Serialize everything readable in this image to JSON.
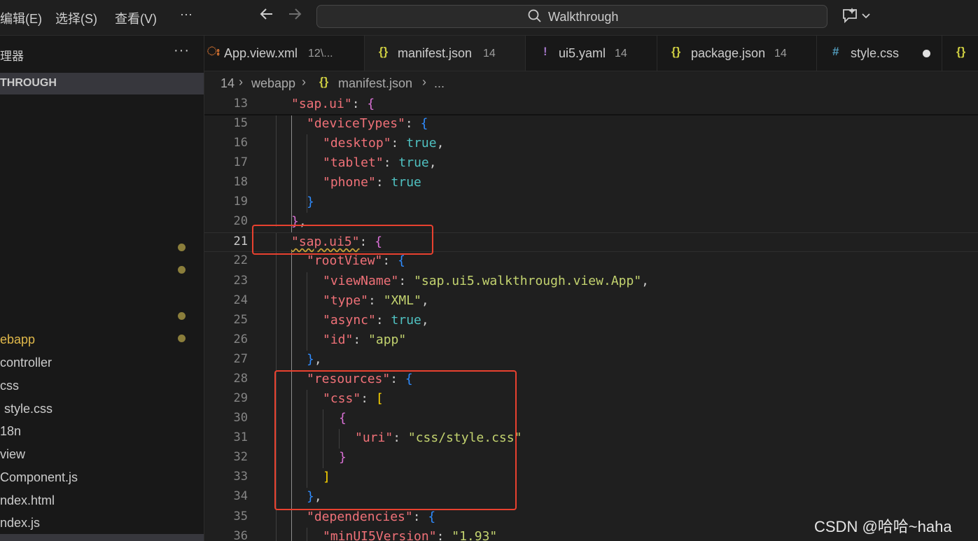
{
  "menu": {
    "edit": "编辑(E)",
    "select": "选择(S)",
    "view": "查看(V)",
    "more": "···"
  },
  "search": {
    "text": "Walkthrough",
    "icon": "search-icon"
  },
  "sidebar": {
    "title": "理器",
    "more": "···",
    "project": "THROUGH",
    "tree": {
      "webapp": "ebapp",
      "controller": "controller",
      "css": "css",
      "style_css": "style.css",
      "i18n": "18n",
      "view": "view",
      "component": "Component.js",
      "index_html": "ndex.html",
      "index_js": "ndex.js"
    }
  },
  "tabs": [
    {
      "icon": "ಃ",
      "icon_name": "rss-icon",
      "name": "App.view.xml",
      "badge": "12\\..."
    },
    {
      "icon": "{}",
      "icon_name": "json-icon",
      "name": "manifest.json",
      "badge": "14"
    },
    {
      "icon": "!",
      "icon_name": "yaml-icon",
      "name": "ui5.yaml",
      "badge": "14"
    },
    {
      "icon": "{}",
      "icon_name": "json-icon",
      "name": "package.json",
      "badge": "14"
    },
    {
      "icon": "#",
      "icon_name": "css-icon",
      "name": "style.css",
      "badge": ""
    },
    {
      "icon": "{}",
      "icon_name": "json-icon",
      "name": "",
      "badge": ""
    }
  ],
  "breadcrumb": {
    "root": "14",
    "folder": "webapp",
    "file": "manifest.json",
    "more": "..."
  },
  "code": {
    "l13": {
      "n": "13",
      "key": "\"sap.ui\""
    },
    "l15": {
      "n": "15",
      "key": "\"deviceTypes\""
    },
    "l16": {
      "n": "16",
      "key": "\"desktop\"",
      "val": "true"
    },
    "l17": {
      "n": "17",
      "key": "\"tablet\"",
      "val": "true"
    },
    "l18": {
      "n": "18",
      "key": "\"phone\"",
      "val": "true"
    },
    "l19": {
      "n": "19"
    },
    "l20": {
      "n": "20"
    },
    "l21": {
      "n": "21",
      "key": "\"sap.ui5\""
    },
    "l22": {
      "n": "22",
      "key": "\"rootView\""
    },
    "l23": {
      "n": "23",
      "key": "\"viewName\"",
      "val": "\"sap.ui5.walkthrough.view.App\""
    },
    "l24": {
      "n": "24",
      "key": "\"type\"",
      "val": "\"XML\""
    },
    "l25": {
      "n": "25",
      "key": "\"async\"",
      "val": "true"
    },
    "l26": {
      "n": "26",
      "key": "\"id\"",
      "val": "\"app\""
    },
    "l27": {
      "n": "27"
    },
    "l28": {
      "n": "28",
      "key": "\"resources\""
    },
    "l29": {
      "n": "29",
      "key": "\"css\""
    },
    "l30": {
      "n": "30"
    },
    "l31": {
      "n": "31",
      "key": "\"uri\"",
      "val": "\"css/style.css\""
    },
    "l32": {
      "n": "32"
    },
    "l33": {
      "n": "33"
    },
    "l34": {
      "n": "34"
    },
    "l35": {
      "n": "35",
      "key": "\"dependencies\""
    },
    "l36": {
      "n": "36",
      "key": "\"minUI5Version\"",
      "val": "\"1.93\""
    }
  },
  "watermark": "CSDN @哈哈~haha",
  "colors": {
    "annotation_box": "#e8412f",
    "key": "#f07178",
    "string": "#c3d36f",
    "boolean": "#4fc1c1"
  }
}
